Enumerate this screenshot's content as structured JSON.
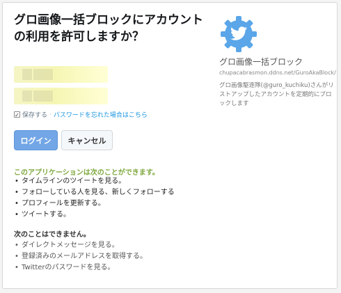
{
  "dialog": {
    "title": "グロ画像一括ブロックにアカウントの利用を許可しますか？",
    "remember_label": "保存する",
    "separator": "·",
    "forgot_password_link": "パスワードを忘れた場合はこちら",
    "login_button": "ログイン",
    "cancel_button": "キャンセル"
  },
  "permissions": {
    "can_heading": "このアプリケーションは次のことができます。",
    "can_items": [
      "タイムラインのツイートを見る。",
      "フォローしている人を見る、新しくフォローする",
      "プロフィールを更新する。",
      "ツイートする。"
    ],
    "cannot_heading": "次のことはできません。",
    "cannot_items": [
      "ダイレクトメッセージを見る。",
      "登録済みのメールアドレスを取得する。",
      "Twitterのパスワードを見る。"
    ]
  },
  "app": {
    "icon": "twitter-bird-gear-icon",
    "name": "グロ画像一括ブロック",
    "url": "chupacabrasmon.ddns.net/GuroAkaBlock/",
    "description": "グロ画像駆逐隊(@guro_kuchiku)さんがリストアップしたアカウントを定期的にブロックします"
  },
  "colors": {
    "login_button": "#72a6e6",
    "can_heading": "#7ea83e",
    "link": "#1b95e0",
    "app_icon": "#5aa6e8"
  }
}
